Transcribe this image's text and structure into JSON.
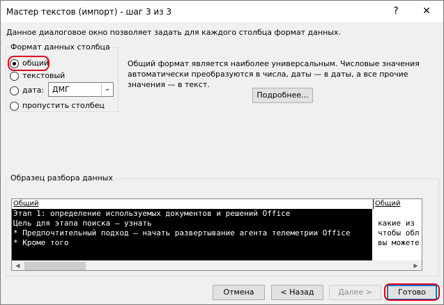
{
  "window": {
    "title": "Мастер текстов (импорт) - шаг 3 из 3",
    "help_glyph": "?",
    "close_glyph": "✕"
  },
  "description": "Данное диалоговое окно позволяет задать для каждого столбца формат данных.",
  "column_format": {
    "group_label": "Формат данных столбца",
    "options": [
      {
        "label": "общий",
        "checked": true
      },
      {
        "label": "текстовый",
        "checked": false
      },
      {
        "label": "дата:",
        "checked": false
      },
      {
        "label": "пропустить столбец",
        "checked": false
      }
    ],
    "date_format_value": "ДМГ",
    "dropdown_glyph": "⌄"
  },
  "info": {
    "text": "Общий формат является наиболее универсальным. Числовые значения автоматически преобразуются в числа, даты — в даты, а все прочие значения — в текст.",
    "more_button": "Подробнее..."
  },
  "preview": {
    "group_label": "Образец разбора данных",
    "columns": [
      "Общий",
      "Общий"
    ],
    "col1_lines": [
      "Этап 1: определение используемых документов и решений Office",
      "Цель для этапа поиска — узнать",
      "* Предпочтительный подход — начать развертывание агента телеметрии Office",
      "* Кроме того"
    ],
    "col2_lines": [
      "какие из",
      "чтобы обл",
      "вы можете"
    ]
  },
  "buttons": {
    "cancel": "Отмена",
    "back": "< Назад",
    "next": "Далее >",
    "finish": "Готово"
  },
  "accent_colors": {
    "highlight": "#e2001a",
    "focus": "#0078d7"
  }
}
